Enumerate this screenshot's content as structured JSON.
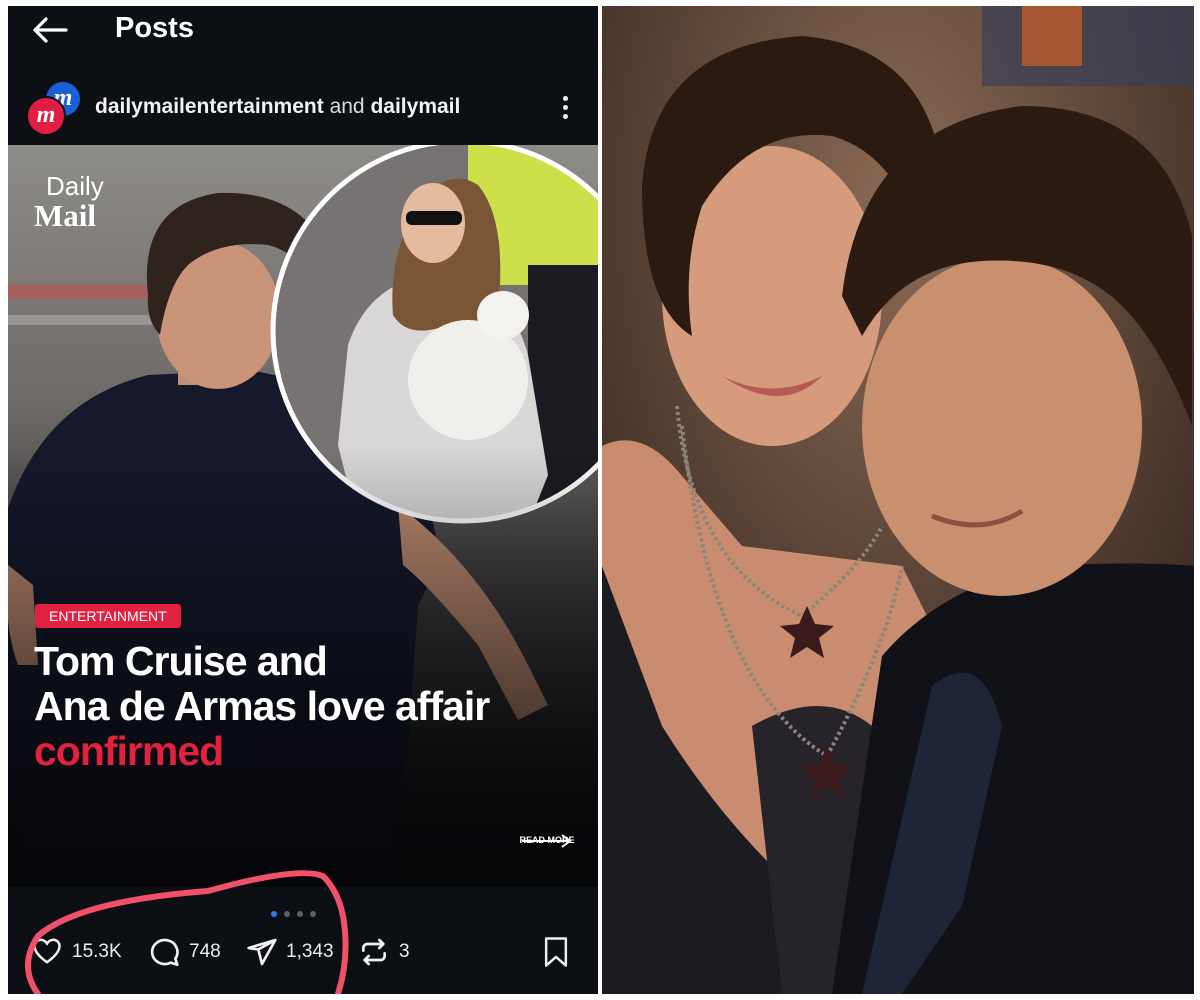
{
  "header": {
    "back_icon": "arrow-left-icon",
    "title": "Posts"
  },
  "author": {
    "avatar_letter": "m",
    "account_one": "dailymailentertainment",
    "connector": "and",
    "account_two": "dailymail",
    "more_icon": "more-vertical-icon"
  },
  "post": {
    "brand_line1": "Daily",
    "brand_line2": "Mail",
    "category": "ENTERTAINMENT",
    "headline_line1": "Tom Cruise and",
    "headline_line2": "Ana de Armas love affair",
    "headline_accent": "confirmed",
    "read_more": "READ MORE",
    "carousel_index": 1,
    "carousel_total": 4
  },
  "actions": {
    "likes": "15.3K",
    "comments": "748",
    "shares": "1,343",
    "reposts": "3"
  },
  "colors": {
    "accent_red": "#e0213f",
    "brand_blue": "#1a5fd6",
    "annotation_red": "#f0506a",
    "background": "#0c0f14"
  }
}
